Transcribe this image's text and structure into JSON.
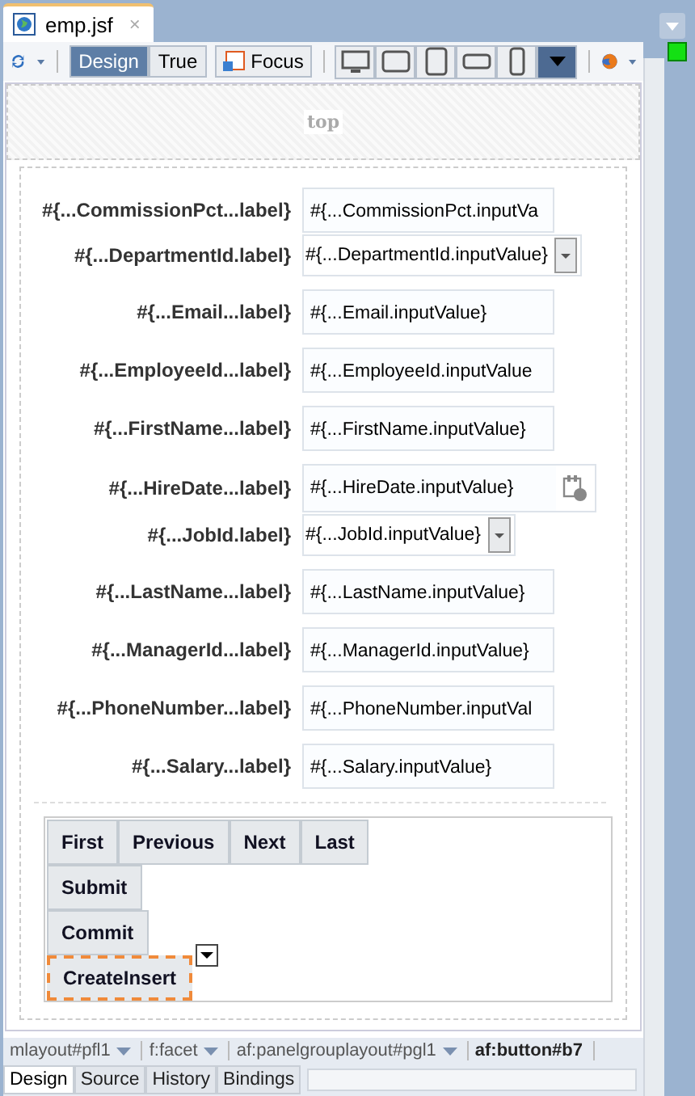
{
  "file_tab": {
    "title": "emp.jsf",
    "close": "×"
  },
  "toolbar": {
    "modes": [
      {
        "label": "Design",
        "selected": true
      },
      {
        "label": "True",
        "selected": false
      }
    ],
    "focus_button": "Focus",
    "devices": [
      {
        "kind": "monitor",
        "selected": false
      },
      {
        "kind": "tablet-landscape",
        "selected": false
      },
      {
        "kind": "tablet",
        "selected": false
      },
      {
        "kind": "phone-landscape",
        "selected": false
      },
      {
        "kind": "phone",
        "selected": false
      },
      {
        "kind": "menu",
        "selected": true
      }
    ]
  },
  "top_facet": "top",
  "fields": [
    {
      "label": "#{...CommissionPct...label}",
      "value": "#{...CommissionPct.inputVa",
      "kind": "text"
    },
    {
      "label": "#{...DepartmentId.label}",
      "value": "#{...DepartmentId.inputValue}",
      "kind": "choice"
    },
    {
      "label": "#{...Email...label}",
      "value": "#{...Email.inputValue}",
      "kind": "text"
    },
    {
      "label": "#{...EmployeeId...label}",
      "value": "#{...EmployeeId.inputValue",
      "kind": "text"
    },
    {
      "label": "#{...FirstName...label}",
      "value": "#{...FirstName.inputValue}",
      "kind": "text"
    },
    {
      "label": "#{...HireDate...label}",
      "value": "#{...HireDate.inputValue}",
      "kind": "date"
    },
    {
      "label": "#{...JobId.label}",
      "value": "#{...JobId.inputValue}",
      "kind": "choice"
    },
    {
      "label": "#{...LastName...label}",
      "value": "#{...LastName.inputValue}",
      "kind": "text"
    },
    {
      "label": "#{...ManagerId...label}",
      "value": "#{...ManagerId.inputValue}",
      "kind": "text"
    },
    {
      "label": "#{...PhoneNumber...label}",
      "value": "#{...PhoneNumber.inputVal",
      "kind": "text"
    },
    {
      "label": "#{...Salary...label}",
      "value": "#{...Salary.inputValue}",
      "kind": "text"
    }
  ],
  "button_rows": [
    [
      {
        "label": "First",
        "selected": false
      },
      {
        "label": "Previous",
        "selected": false
      },
      {
        "label": "Next",
        "selected": false
      },
      {
        "label": "Last",
        "selected": false
      }
    ],
    [
      {
        "label": "Submit",
        "selected": false
      }
    ],
    [
      {
        "label": "Commit",
        "selected": false
      }
    ],
    [
      {
        "label": "CreateInsert",
        "selected": true
      }
    ]
  ],
  "breadcrumbs": [
    {
      "label": "mlayout#pfl1",
      "selected": false
    },
    {
      "label": "f:facet",
      "selected": false
    },
    {
      "label": "af:panelgrouplayout#pgl1",
      "selected": false
    },
    {
      "label": "af:button#b7",
      "selected": true
    }
  ],
  "bottom_tabs": [
    {
      "label": "Design",
      "selected": true
    },
    {
      "label": "Source",
      "selected": false
    },
    {
      "label": "History",
      "selected": false
    },
    {
      "label": "Bindings",
      "selected": false
    }
  ]
}
